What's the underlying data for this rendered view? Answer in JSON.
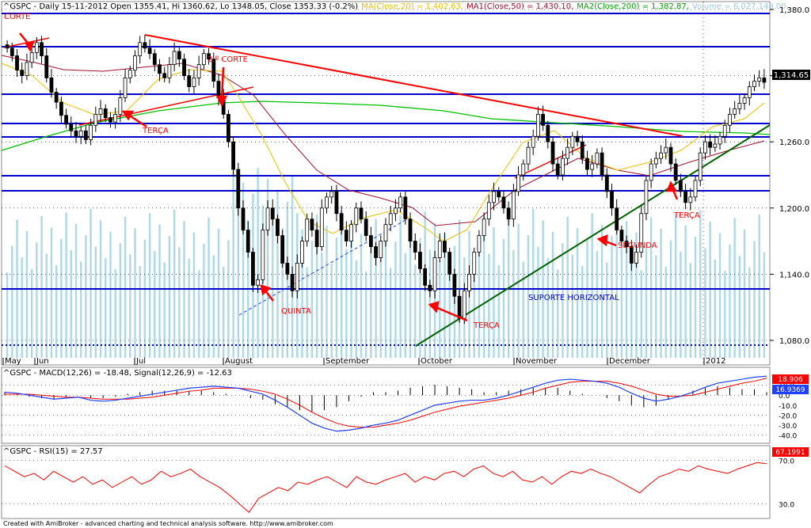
{
  "header": {
    "title": "^GSPC - Daily 15-11-2012 Open 1355.41, Hi 1360.62, Lo 1348.05, Close 1353.33 (-0.2%)",
    "ma20": "MA(Close,20) = 1,402.63,",
    "ma50": "MA1(Close,50) = 1,430.10,",
    "ma200": "MA2(Close,200) = 1,382.87,",
    "volume": "Volume = 6,027,149.00,"
  },
  "colors": {
    "up": "#000000",
    "down": "#000000",
    "volume": "#add8e6",
    "ma20": "#e8c000",
    "ma50": "#a01030",
    "ma200": "#00c000",
    "resistance": "#ff0000",
    "horizontal": "#0000cc",
    "support": "#006400",
    "macd": "#2040ff",
    "signal": "#ff0000",
    "rsi": "#ff0000"
  },
  "chart_data": [
    {
      "type": "candlestick",
      "y_ticks": [
        "1,380.0",
        "1,320.0",
        "1,260.0",
        "1,200.0",
        "1,140.0",
        "1,080.0"
      ],
      "ylim": [
        1070,
        1385
      ],
      "x_labels": [
        "May",
        "Jun",
        "Jul",
        "August",
        "September",
        "October",
        "November",
        "December",
        "2012"
      ],
      "last_price_label": "1,314.65",
      "closes": [
        1345,
        1338,
        1325,
        1320,
        1332,
        1341,
        1350,
        1338,
        1318,
        1305,
        1296,
        1284,
        1276,
        1270,
        1265,
        1270,
        1262,
        1275,
        1285,
        1290,
        1282,
        1278,
        1285,
        1300,
        1318,
        1325,
        1338,
        1350,
        1345,
        1340,
        1330,
        1322,
        1318,
        1330,
        1342,
        1335,
        1320,
        1310,
        1318,
        1330,
        1340,
        1335,
        1315,
        1300,
        1285,
        1260,
        1235,
        1200,
        1180,
        1160,
        1130,
        1135,
        1180,
        1200,
        1190,
        1175,
        1150,
        1140,
        1125,
        1150,
        1170,
        1190,
        1180,
        1165,
        1200,
        1210,
        1215,
        1195,
        1180,
        1170,
        1185,
        1200,
        1190,
        1175,
        1165,
        1155,
        1170,
        1185,
        1195,
        1200,
        1210,
        1190,
        1170,
        1160,
        1145,
        1130,
        1125,
        1155,
        1170,
        1160,
        1140,
        1120,
        1100,
        1125,
        1140,
        1160,
        1175,
        1190,
        1205,
        1215,
        1210,
        1200,
        1190,
        1215,
        1230,
        1240,
        1255,
        1265,
        1285,
        1275,
        1260,
        1240,
        1230,
        1245,
        1255,
        1265,
        1260,
        1245,
        1235,
        1240,
        1250,
        1230,
        1215,
        1200,
        1180,
        1170,
        1165,
        1150,
        1160,
        1195,
        1225,
        1240,
        1245,
        1250,
        1255,
        1240,
        1225,
        1215,
        1205,
        1210,
        1225,
        1250,
        1260,
        1255,
        1258,
        1265,
        1275,
        1285,
        1290,
        1295,
        1300,
        1310,
        1315,
        1318,
        1314
      ]
    },
    {
      "type": "line",
      "title": "^GSPC - MACD(12,26) = -18.48, Signal(12,26,9) = -12.63",
      "y_ticks": [
        "10.0",
        "0.0",
        "-10.0",
        "-20.0",
        "-30.0",
        "-40.0"
      ],
      "ylim": [
        -45,
        20
      ],
      "badges": [
        "18.906",
        "16.9369"
      ],
      "series": [
        {
          "name": "MACD",
          "values": [
            3,
            2,
            0,
            -2,
            -4,
            -3,
            -2,
            -5,
            -6,
            -5,
            -3,
            -1,
            1,
            3,
            5,
            7,
            8,
            9,
            8,
            7,
            4,
            1,
            -5,
            -12,
            -20,
            -28,
            -33,
            -36,
            -35,
            -33,
            -30,
            -28,
            -25,
            -20,
            -15,
            -10,
            -8,
            -6,
            -5,
            -5,
            -3,
            0,
            4,
            8,
            12,
            15,
            16,
            15,
            14,
            12,
            8,
            2,
            -3,
            -6,
            -4,
            -1,
            3,
            8,
            12,
            14,
            16,
            18,
            19
          ]
        },
        {
          "name": "Signal",
          "values": [
            1,
            1,
            1,
            0,
            -1,
            -2,
            -2,
            -3,
            -4,
            -4,
            -4,
            -3,
            -2,
            0,
            2,
            4,
            5,
            7,
            7,
            7,
            6,
            4,
            1,
            -4,
            -10,
            -17,
            -23,
            -28,
            -31,
            -32,
            -32,
            -30,
            -28,
            -25,
            -21,
            -17,
            -14,
            -11,
            -9,
            -7,
            -5,
            -3,
            0,
            3,
            7,
            10,
            13,
            14,
            14,
            14,
            12,
            9,
            5,
            1,
            -1,
            -1,
            0,
            3,
            6,
            9,
            12,
            14,
            17
          ]
        }
      ]
    },
    {
      "type": "line",
      "title": "^GSPC - RSI(15) = 27.57",
      "y_ticks": [
        "70.0",
        "30.0"
      ],
      "ylim": [
        20,
        80
      ],
      "badge": "67.1991",
      "series": [
        {
          "name": "RSI",
          "values": [
            65,
            60,
            55,
            58,
            52,
            60,
            55,
            50,
            55,
            48,
            52,
            45,
            50,
            55,
            48,
            52,
            60,
            55,
            58,
            62,
            55,
            50,
            45,
            38,
            30,
            22,
            35,
            40,
            45,
            42,
            50,
            48,
            52,
            55,
            50,
            45,
            55,
            50,
            48,
            52,
            55,
            58,
            50,
            55,
            52,
            58,
            60,
            55,
            62,
            65,
            58,
            55,
            60,
            52,
            50,
            55,
            48,
            55,
            60,
            58,
            62,
            58,
            55,
            50,
            45,
            40,
            48,
            55,
            58,
            62,
            60,
            65,
            62,
            60,
            58,
            62,
            65,
            68,
            67
          ]
        }
      ]
    }
  ],
  "annotations": {
    "corte": "CORTE",
    "corte2": "2.º CORTE",
    "terca1": "TERÇA",
    "quinta": "QUINTA",
    "terca2": "TERÇA",
    "segunda": "SEGUNDA",
    "terca3": "TERÇA",
    "suporte": "SUPORTE HORIZONTAL"
  },
  "footer": "Created with AmiBroker - advanced charting and technical analysis software. http://www.amibroker.com"
}
